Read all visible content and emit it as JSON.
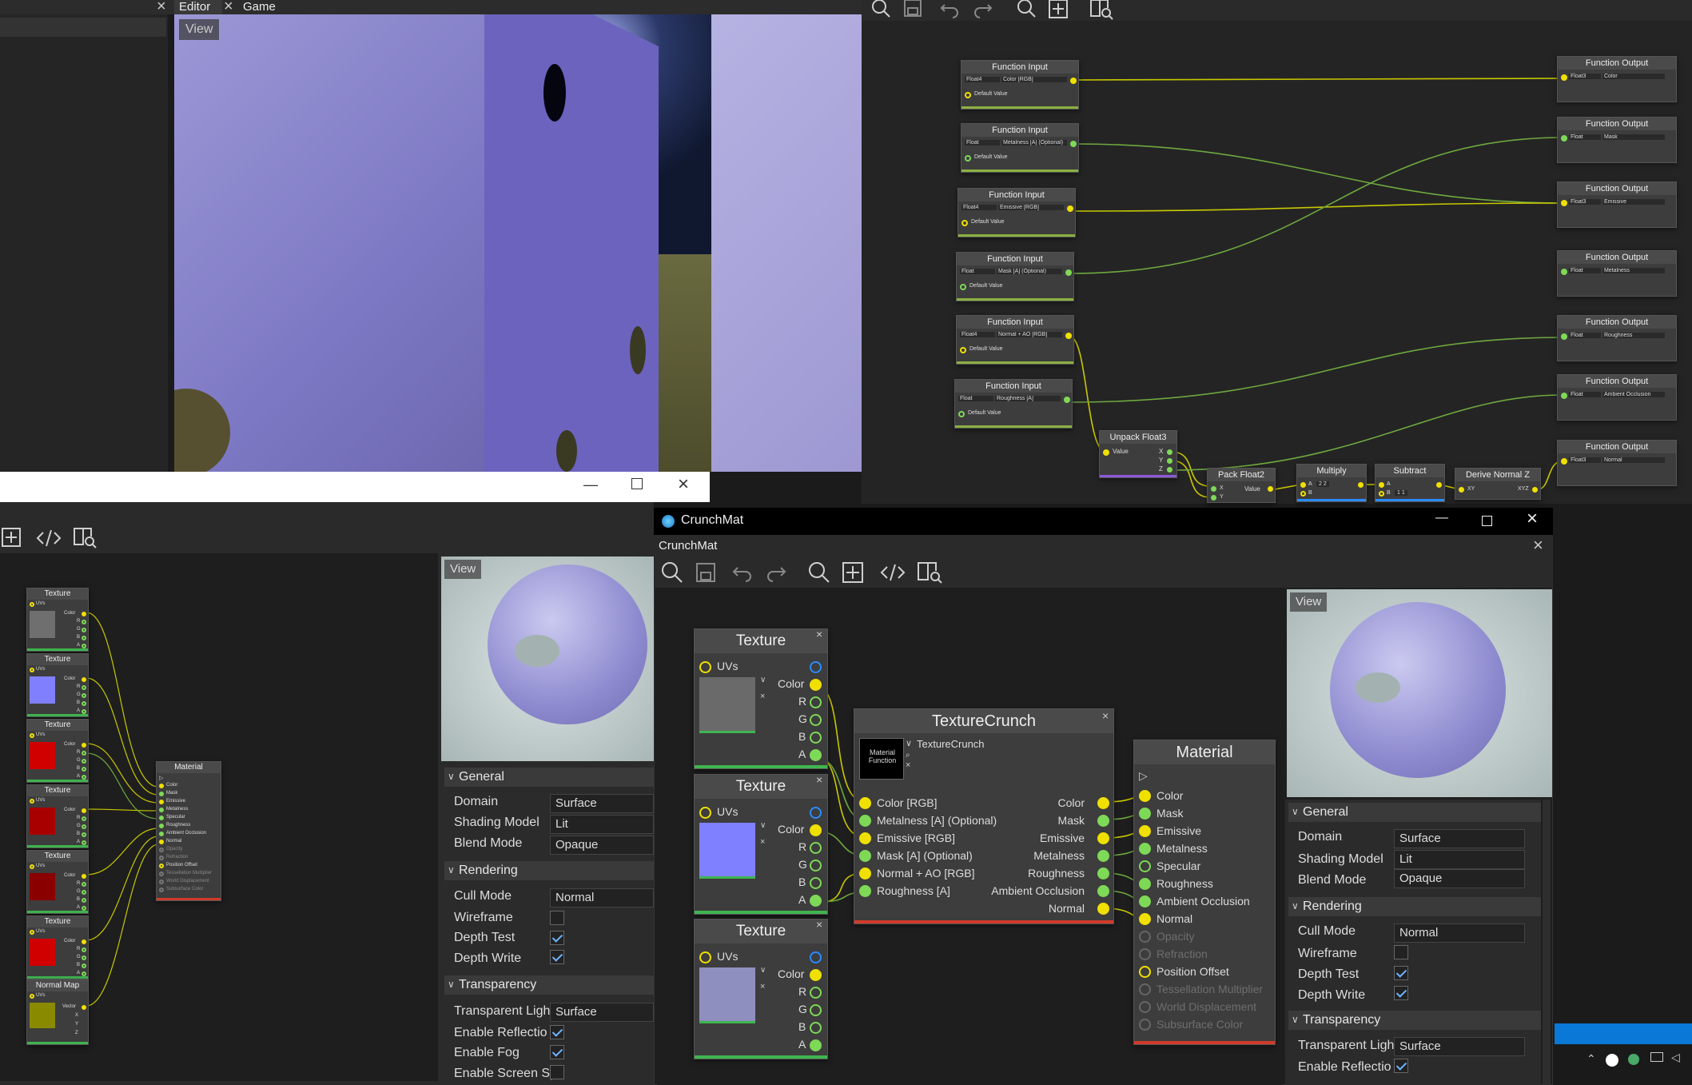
{
  "editor_tabs": {
    "tab1": "Editor",
    "tab2": "Game"
  },
  "viewport": {
    "view_label": "View"
  },
  "graph_top": {
    "inputs": [
      {
        "title": "Function Input",
        "type": "Float4",
        "name": "Color [RGB]",
        "default": "Default Value"
      },
      {
        "title": "Function Input",
        "type": "Float",
        "name": "Metalness [A] (Optional)",
        "default": "Default Value"
      },
      {
        "title": "Function Input",
        "type": "Float4",
        "name": "Emissive [RGB]",
        "default": "Default Value"
      },
      {
        "title": "Function Input",
        "type": "Float",
        "name": "Mask [A] (Optional)",
        "default": "Default Value"
      },
      {
        "title": "Function Input",
        "type": "Float4",
        "name": "Normal + AO [RGB]",
        "default": "Default Value"
      },
      {
        "title": "Function Input",
        "type": "Float",
        "name": "Roughness [A]",
        "default": "Default Value"
      }
    ],
    "outputs": [
      {
        "title": "Function Output",
        "type": "Float3",
        "name": "Color"
      },
      {
        "title": "Function Output",
        "type": "Float",
        "name": "Mask"
      },
      {
        "title": "Function Output",
        "type": "Float3",
        "name": "Emissive"
      },
      {
        "title": "Function Output",
        "type": "Float",
        "name": "Metalness"
      },
      {
        "title": "Function Output",
        "type": "Float",
        "name": "Roughness"
      },
      {
        "title": "Function Output",
        "type": "Float",
        "name": "Ambient Occlusion"
      },
      {
        "title": "Function Output",
        "type": "Float3",
        "name": "Normal"
      }
    ],
    "unpack": {
      "title": "Unpack Float3",
      "in": "Value",
      "x": "X",
      "y": "Y",
      "z": "Z"
    },
    "pack": {
      "title": "Pack Float2",
      "x": "X",
      "y": "Y",
      "out": "Value"
    },
    "multiply": {
      "title": "Multiply",
      "a": "A",
      "a_vals": "2   2",
      "b": "B"
    },
    "subtract": {
      "title": "Subtract",
      "a": "A",
      "b": "B",
      "b_vals": "1   1"
    },
    "derive": {
      "title": "Derive Normal Z",
      "in": "XY",
      "out": "XYZ"
    }
  },
  "left_graph": {
    "textures": [
      {
        "title": "Texture",
        "uvs": "UVs",
        "color": "Color",
        "r": "R",
        "g": "G",
        "b": "B",
        "a": "A",
        "swatch": "#6f6f6f"
      },
      {
        "title": "Texture",
        "uvs": "UVs",
        "color": "Color",
        "r": "R",
        "g": "G",
        "b": "B",
        "a": "A",
        "swatch": "#8080ff"
      },
      {
        "title": "Texture",
        "uvs": "UVs",
        "color": "Color",
        "r": "R",
        "g": "G",
        "b": "B",
        "a": "A",
        "swatch": "#d00000"
      },
      {
        "title": "Texture",
        "uvs": "UVs",
        "color": "Color",
        "r": "R",
        "g": "G",
        "b": "B",
        "a": "A",
        "swatch": "#a80000"
      },
      {
        "title": "Texture",
        "uvs": "UVs",
        "color": "Color",
        "r": "R",
        "g": "G",
        "b": "B",
        "a": "A",
        "swatch": "#8a0000"
      },
      {
        "title": "Texture",
        "uvs": "UVs",
        "color": "Color",
        "r": "R",
        "g": "G",
        "b": "B",
        "a": "A",
        "swatch": "#d00000"
      }
    ],
    "normal_map": {
      "title": "Normal Map",
      "uvs": "UVs",
      "out": "Vector",
      "x": "X",
      "y": "Y",
      "z": "Z",
      "swatch": "#8a8a00"
    },
    "material": {
      "title": "Material",
      "pins": [
        "Color",
        "Mask",
        "Emissive",
        "Metalness",
        "Specular",
        "Roughness",
        "Ambient Occlusion",
        "Normal",
        "Opacity",
        "Refraction",
        "Position Offset",
        "Tessellation Multiplier",
        "World Displacement",
        "Subsurface Color"
      ]
    }
  },
  "left_props": {
    "view_label": "View",
    "general": "General",
    "domain_label": "Domain",
    "domain": "Surface",
    "shading_label": "Shading Model",
    "shading": "Lit",
    "blend_label": "Blend Mode",
    "blend": "Opaque",
    "rendering": "Rendering",
    "cull_label": "Cull Mode",
    "cull": "Normal",
    "wireframe_label": "Wireframe",
    "depth_test_label": "Depth Test",
    "depth_write_label": "Depth Write",
    "transparency": "Transparency",
    "transparent_label": "Transparent Ligh",
    "transparent": "Surface",
    "reflection_label": "Enable Reflectio",
    "fog_label": "Enable Fog",
    "screen_label": "Enable Screen Sp"
  },
  "crunch_window": {
    "window_title": "CrunchMat",
    "tab_title": "CrunchMat",
    "textures": [
      {
        "title": "Texture",
        "uvs": "UVs",
        "color": "Color",
        "r": "R",
        "g": "G",
        "b": "B",
        "a": "A",
        "swatch": "#6a6a6a"
      },
      {
        "title": "Texture",
        "uvs": "UVs",
        "color": "Color",
        "r": "R",
        "g": "G",
        "b": "B",
        "a": "A",
        "swatch": "#7f80ff"
      },
      {
        "title": "Texture",
        "uvs": "UVs",
        "color": "Color",
        "r": "R",
        "g": "G",
        "b": "B",
        "a": "A",
        "swatch": "#8f8fbf"
      }
    ],
    "crunch": {
      "title": "TextureCrunch",
      "function_label": "Material Function",
      "function_name": "TextureCrunch",
      "inputs": [
        "Color [RGB]",
        "Metalness [A] (Optional)",
        "Emissive [RGB]",
        "Mask [A] (Optional)",
        "Normal + AO [RGB]",
        "Roughness [A]"
      ],
      "outputs": [
        "Color",
        "Mask",
        "Emissive",
        "Metalness",
        "Roughness",
        "Ambient Occlusion",
        "Normal"
      ]
    },
    "material": {
      "title": "Material",
      "pins": [
        "Color",
        "Mask",
        "Emissive",
        "Metalness",
        "Specular",
        "Roughness",
        "Ambient Occlusion",
        "Normal",
        "Opacity",
        "Refraction",
        "Position Offset",
        "Tessellation Multiplier",
        "World Displacement",
        "Subsurface Color"
      ]
    },
    "props": {
      "view_label": "View",
      "general": "General",
      "domain_label": "Domain",
      "domain": "Surface",
      "shading_label": "Shading Model",
      "shading": "Lit",
      "blend_label": "Blend Mode",
      "blend": "Opaque",
      "rendering": "Rendering",
      "cull_label": "Cull Mode",
      "cull": "Normal",
      "wireframe_label": "Wireframe",
      "depth_test_label": "Depth Test",
      "depth_write_label": "Depth Write",
      "transparency": "Transparency",
      "transparent_label": "Transparent Ligh",
      "transparent": "Surface",
      "reflection_label": "Enable Reflectio"
    }
  },
  "colors": {
    "yellow_pin": "#f0e000",
    "green_pin": "#7ed957",
    "blue_pin": "#2a8cff",
    "accent_blue": "#0a78d7",
    "node_red": "#d03a2a",
    "node_green": "#3fb54f"
  }
}
